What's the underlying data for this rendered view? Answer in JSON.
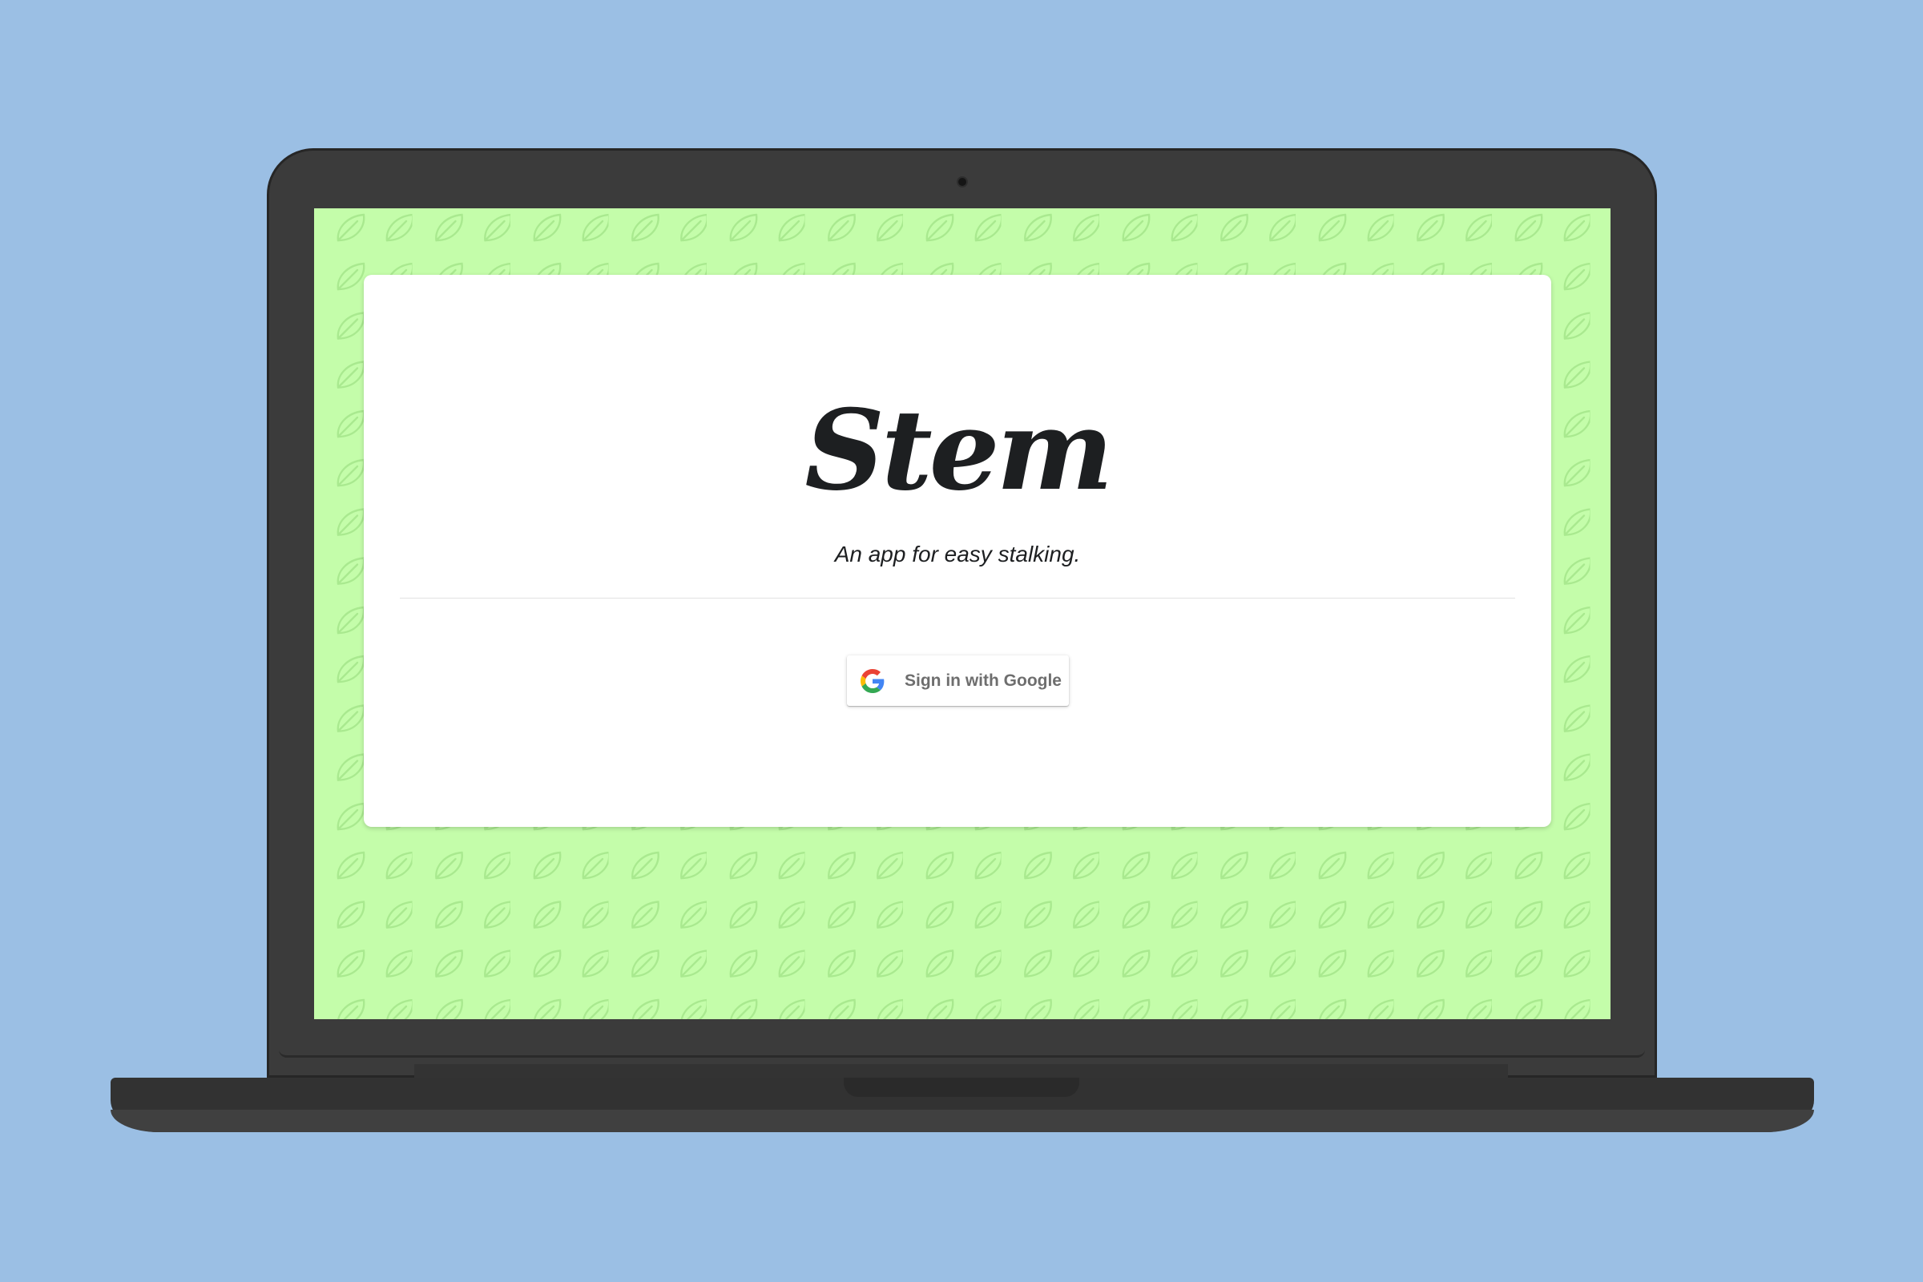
{
  "app": {
    "title": "Stem",
    "tagline": "An app for easy stalking."
  },
  "signin": {
    "label": "Sign in with Google",
    "icon": "google-g-icon"
  },
  "colors": {
    "page_background": "#9bbfe4",
    "screen_background": "#c4fdaa",
    "pattern_leaf": "#a9e98f",
    "card_background": "#ffffff",
    "logo_text": "#1d1f21",
    "button_text": "#6e6e6e",
    "laptop_body": "#3b3b3b"
  },
  "decor": {
    "background_pattern_icon": "leaf-icon"
  }
}
